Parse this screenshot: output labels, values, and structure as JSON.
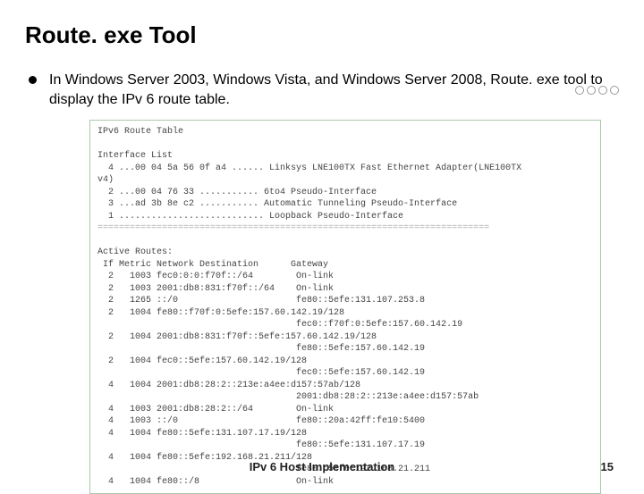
{
  "title": "Route. exe Tool",
  "bullet": "In Windows Server 2003, Windows Vista, and Windows Server 2008, Route. exe tool to display the IPv 6 route table.",
  "cmd": {
    "header": "IPv6 Route Table",
    "if_list_heading": "Interface List",
    "if1": "  4 ...00 04 5a 56 0f a4 ...... Linksys LNE100TX Fast Ethernet Adapter(LNE100TX",
    "if1b": "v4)",
    "if2": "  2 ...00 04 76 33 ........... 6to4 Pseudo-Interface",
    "if3": "  3 ...ad 3b 8e c2 ........... Automatic Tunneling Pseudo-Interface",
    "if4": "  1 ........................... Loopback Pseudo-Interface",
    "sep": "=========================================================================",
    "active_heading": "Active Routes:",
    "cols": " If Metric Network Destination      Gateway",
    "r1": "  2   1003 fec0:0:0:f70f::/64        On-link",
    "r2": "  2   1003 2001:db8:831:f70f::/64    On-link",
    "r3": "  2   1265 ::/0                      fe80::5efe:131.107.253.8",
    "r4": "  2   1004 fe80::f70f:0:5efe:157.60.142.19/128",
    "r5": "                                     fec0::f70f:0:5efe:157.60.142.19",
    "r6": "  2   1004 2001:db8:831:f70f::5efe:157.60.142.19/128",
    "r7": "                                     fe80::5efe:157.60.142.19",
    "r8": "  2   1004 fec0::5efe:157.60.142.19/128",
    "r9": "                                     fec0::5efe:157.60.142.19",
    "r10": "  4   1004 2001:db8:28:2::213e:a4ee:d157:57ab/128",
    "r11": "                                     2001:db8:28:2::213e:a4ee:d157:57ab",
    "r12": "  4   1003 2001:db8:28:2::/64        On-link",
    "r13": "  4   1003 ::/0                      fe80::20a:42ff:fe10:5400",
    "r14": "  4   1004 fe80::5efe:131.107.17.19/128",
    "r15": "                                     fe80::5efe:131.107.17.19",
    "r16": "  4   1004 fe80::5efe:192.168.21.211/128",
    "r17": "                                     fe80::5efe:192.168.21.211",
    "r18": "  4   1004 fe80::/8                  On-link"
  },
  "footer": "IPv 6 Host Implementation",
  "page": "15"
}
